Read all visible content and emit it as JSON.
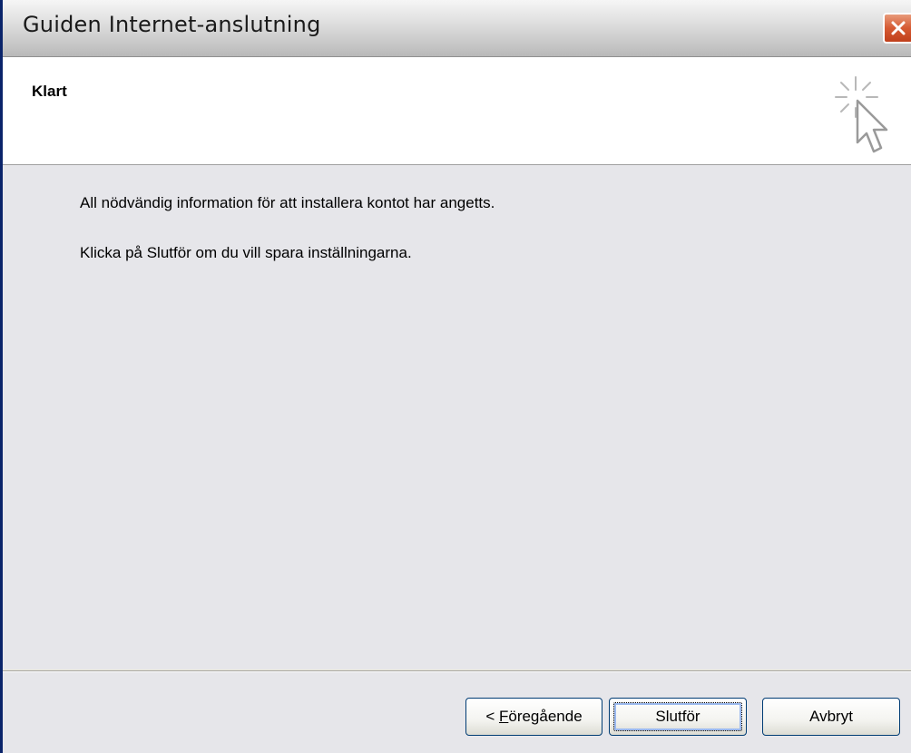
{
  "window": {
    "title": "Guiden Internet-anslutning",
    "close_icon": "close-icon"
  },
  "header": {
    "heading": "Klart",
    "icon": "sparkle-cursor-icon"
  },
  "content": {
    "line1": "All nödvändig information för att installera kontot har angetts.",
    "line2": "Klicka på Slutför om du vill spara inställningarna."
  },
  "buttons": {
    "prev_prefix": "< ",
    "prev_mnemonic": "F",
    "prev_rest": "öregående",
    "finish": "Slutför",
    "cancel": "Avbryt"
  },
  "colors": {
    "close_button": "#d65a33",
    "button_border": "#003c74",
    "content_background": "#e6e6ea"
  }
}
